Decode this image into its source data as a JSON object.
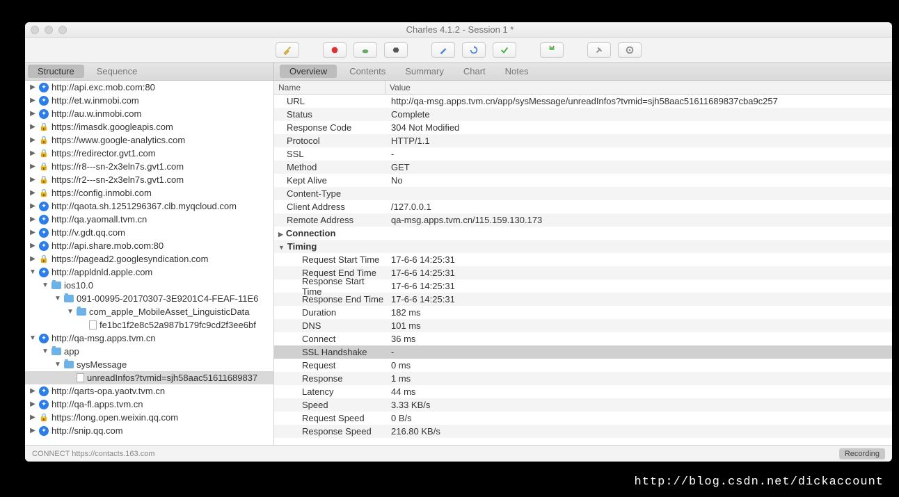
{
  "window": {
    "title": "Charles 4.1.2 - Session 1 *"
  },
  "tabs": {
    "left": [
      {
        "label": "Structure",
        "active": true
      },
      {
        "label": "Sequence",
        "active": false
      }
    ],
    "right": [
      {
        "label": "Overview",
        "active": true
      },
      {
        "label": "Contents",
        "active": false
      },
      {
        "label": "Summary",
        "active": false
      },
      {
        "label": "Chart",
        "active": false
      },
      {
        "label": "Notes",
        "active": false
      }
    ]
  },
  "toolbar_icons": [
    "broom",
    "record",
    "turtle",
    "hex",
    "pencil",
    "refresh",
    "check",
    "basket",
    "tools",
    "gear"
  ],
  "statusbar": {
    "left": "CONNECT https://contacts.163.com",
    "right": "Recording"
  },
  "watermark": "http://blog.csdn.net/dickaccount",
  "details": {
    "header": {
      "name": "Name",
      "value": "Value"
    },
    "rows": [
      {
        "k": "URL",
        "v": "http://qa-msg.apps.tvm.cn/app/sysMessage/unreadInfos?tvmid=sjh58aac51611689837cba9c257"
      },
      {
        "k": "Status",
        "v": "Complete"
      },
      {
        "k": "Response Code",
        "v": "304 Not Modified"
      },
      {
        "k": "Protocol",
        "v": "HTTP/1.1"
      },
      {
        "k": "SSL",
        "v": "-"
      },
      {
        "k": "Method",
        "v": "GET"
      },
      {
        "k": "Kept Alive",
        "v": "No"
      },
      {
        "k": "Content-Type",
        "v": ""
      },
      {
        "k": "Client Address",
        "v": "/127.0.0.1"
      },
      {
        "k": "Remote Address",
        "v": "qa-msg.apps.tvm.cn/115.159.130.173"
      }
    ],
    "groups": [
      {
        "label": "Connection",
        "open": false,
        "rows": []
      },
      {
        "label": "Timing",
        "open": true,
        "rows": [
          {
            "k": "Request Start Time",
            "v": "17-6-6 14:25:31"
          },
          {
            "k": "Request End Time",
            "v": "17-6-6 14:25:31"
          },
          {
            "k": "Response Start Time",
            "v": "17-6-6 14:25:31"
          },
          {
            "k": "Response End Time",
            "v": "17-6-6 14:25:31"
          },
          {
            "k": "Duration",
            "v": "182 ms"
          },
          {
            "k": "DNS",
            "v": "101 ms"
          },
          {
            "k": "Connect",
            "v": "36 ms"
          },
          {
            "k": "SSL Handshake",
            "v": "-",
            "sel": true
          },
          {
            "k": "Request",
            "v": "0 ms"
          },
          {
            "k": "Response",
            "v": "1 ms"
          },
          {
            "k": "Latency",
            "v": "44 ms"
          },
          {
            "k": "Speed",
            "v": "3.33 KB/s"
          },
          {
            "k": "Request Speed",
            "v": "0 B/s"
          },
          {
            "k": "Response Speed",
            "v": "216.80 KB/s"
          }
        ]
      }
    ]
  },
  "tree": [
    {
      "d": 0,
      "a": "▶",
      "i": "globe-b",
      "t": "http://api.exc.mob.com:80"
    },
    {
      "d": 0,
      "a": "▶",
      "i": "globe-b",
      "t": "http://et.w.inmobi.com"
    },
    {
      "d": 0,
      "a": "▶",
      "i": "globe-b",
      "t": "http://au.w.inmobi.com"
    },
    {
      "d": 0,
      "a": "▶",
      "i": "lock",
      "t": "https://imasdk.googleapis.com"
    },
    {
      "d": 0,
      "a": "▶",
      "i": "lock",
      "t": "https://www.google-analytics.com"
    },
    {
      "d": 0,
      "a": "▶",
      "i": "lock",
      "t": "https://redirector.gvt1.com"
    },
    {
      "d": 0,
      "a": "▶",
      "i": "lock",
      "t": "https://r8---sn-2x3eln7s.gvt1.com"
    },
    {
      "d": 0,
      "a": "▶",
      "i": "lock",
      "t": "https://r2---sn-2x3eln7s.gvt1.com"
    },
    {
      "d": 0,
      "a": "▶",
      "i": "lock",
      "t": "https://config.inmobi.com"
    },
    {
      "d": 0,
      "a": "▶",
      "i": "globe-b",
      "t": "http://qaota.sh.1251296367.clb.myqcloud.com"
    },
    {
      "d": 0,
      "a": "▶",
      "i": "globe-b",
      "t": "http://qa.yaomall.tvm.cn"
    },
    {
      "d": 0,
      "a": "▶",
      "i": "globe-b",
      "t": "http://v.gdt.qq.com"
    },
    {
      "d": 0,
      "a": "▶",
      "i": "globe-b",
      "t": "http://api.share.mob.com:80"
    },
    {
      "d": 0,
      "a": "▶",
      "i": "lock",
      "t": "https://pagead2.googlesyndication.com"
    },
    {
      "d": 0,
      "a": "▼",
      "i": "globe-b",
      "t": "http://appldnld.apple.com"
    },
    {
      "d": 1,
      "a": "▼",
      "i": "folder",
      "t": "ios10.0"
    },
    {
      "d": 2,
      "a": "▼",
      "i": "folder",
      "t": "091-00995-20170307-3E9201C4-FEAF-11E6"
    },
    {
      "d": 3,
      "a": "▼",
      "i": "folder",
      "t": "com_apple_MobileAsset_LinguisticData"
    },
    {
      "d": 4,
      "a": "",
      "i": "file",
      "t": "fe1bc1f2e8c52a987b179fc9cd2f3ee6bf"
    },
    {
      "d": 0,
      "a": "▼",
      "i": "globe-b",
      "t": "http://qa-msg.apps.tvm.cn"
    },
    {
      "d": 1,
      "a": "▼",
      "i": "folder",
      "t": "app"
    },
    {
      "d": 2,
      "a": "▼",
      "i": "folder",
      "t": "sysMessage"
    },
    {
      "d": 3,
      "a": "",
      "i": "file",
      "t": "unreadInfos?tvmid=sjh58aac51611689837",
      "sel": true
    },
    {
      "d": 0,
      "a": "▶",
      "i": "globe-b",
      "t": "http://qarts-opa.yaotv.tvm.cn"
    },
    {
      "d": 0,
      "a": "▶",
      "i": "globe-b",
      "t": "http://qa-fl.apps.tvm.cn"
    },
    {
      "d": 0,
      "a": "▶",
      "i": "lock",
      "t": "https://long.open.weixin.qq.com"
    },
    {
      "d": 0,
      "a": "▶",
      "i": "globe-b",
      "t": "http://snip.qq.com"
    }
  ]
}
